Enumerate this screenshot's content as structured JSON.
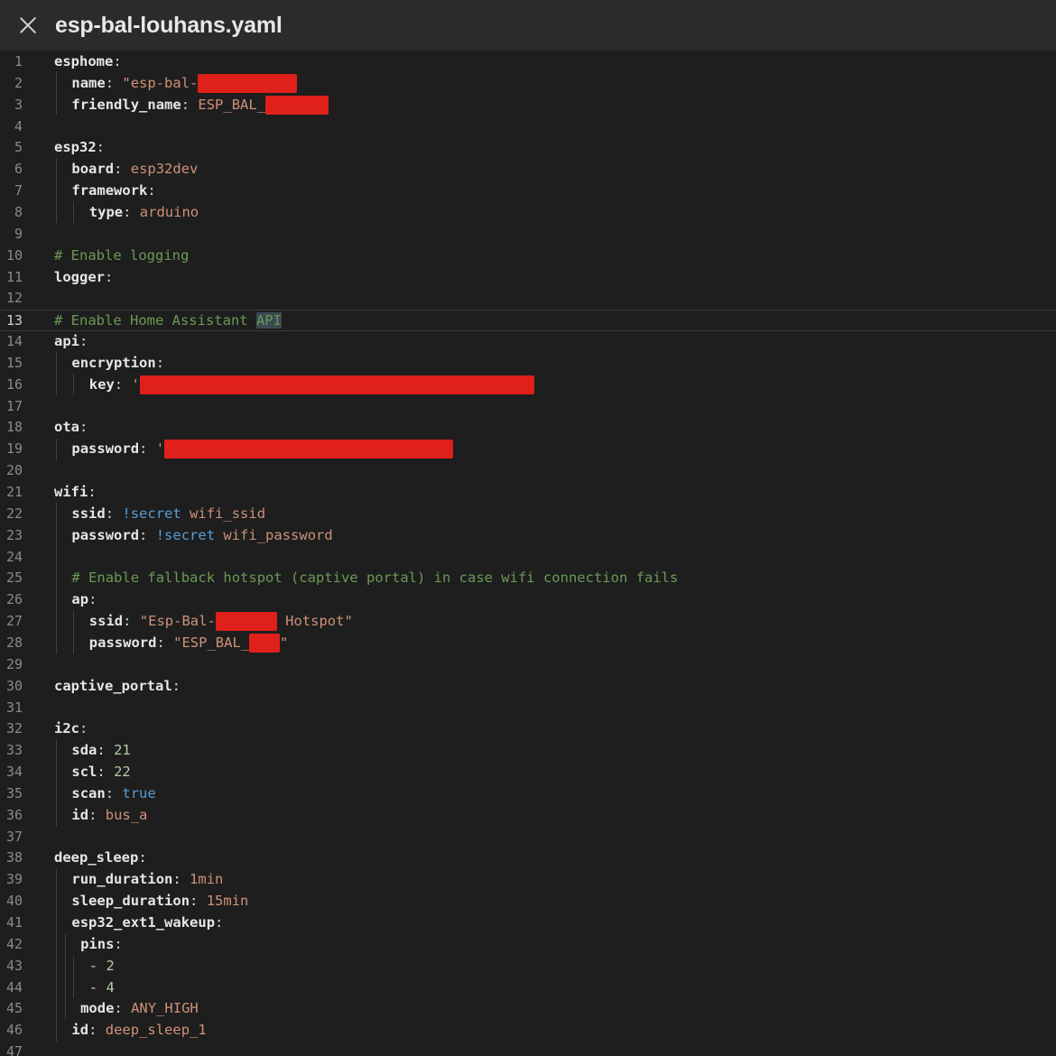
{
  "window": {
    "title": "esp-bal-louhans.yaml",
    "close_icon": "close-icon"
  },
  "colors": {
    "background": "#1e1e1e",
    "key": "#e6e6e6",
    "string": "#ce9178",
    "keyword": "#569cd6",
    "number": "#b5cea8",
    "comment": "#6a9955",
    "redaction": "#e0201a"
  },
  "editor": {
    "current_line": 13,
    "lines": [
      {
        "n": "1",
        "tokens": [
          [
            "k",
            "esphome"
          ],
          [
            "p",
            ":"
          ]
        ]
      },
      {
        "n": "2",
        "indent": 1,
        "tokens": [
          [
            "k",
            "name"
          ],
          [
            "p",
            ": "
          ],
          [
            "s",
            "\"esp-bal-"
          ],
          [
            "r",
            "110"
          ]
        ]
      },
      {
        "n": "3",
        "indent": 1,
        "tokens": [
          [
            "k",
            "friendly_name"
          ],
          [
            "p",
            ": "
          ],
          [
            "s",
            "ESP_BAL_"
          ],
          [
            "r",
            "70"
          ]
        ]
      },
      {
        "n": "4",
        "tokens": []
      },
      {
        "n": "5",
        "tokens": [
          [
            "k",
            "esp32"
          ],
          [
            "p",
            ":"
          ]
        ]
      },
      {
        "n": "6",
        "indent": 1,
        "tokens": [
          [
            "k",
            "board"
          ],
          [
            "p",
            ": "
          ],
          [
            "s",
            "esp32dev"
          ]
        ]
      },
      {
        "n": "7",
        "indent": 1,
        "tokens": [
          [
            "k",
            "framework"
          ],
          [
            "p",
            ":"
          ]
        ]
      },
      {
        "n": "8",
        "indent": 2,
        "tokens": [
          [
            "k",
            "type"
          ],
          [
            "p",
            ": "
          ],
          [
            "s",
            "arduino"
          ]
        ]
      },
      {
        "n": "9",
        "tokens": []
      },
      {
        "n": "10",
        "tokens": [
          [
            "c",
            "# Enable logging"
          ]
        ]
      },
      {
        "n": "11",
        "tokens": [
          [
            "k",
            "logger"
          ],
          [
            "p",
            ":"
          ]
        ]
      },
      {
        "n": "12",
        "tokens": []
      },
      {
        "n": "13",
        "tokens": [
          [
            "c",
            "# Enable Home Assistant "
          ],
          [
            "h",
            "API"
          ]
        ]
      },
      {
        "n": "14",
        "tokens": [
          [
            "k",
            "api"
          ],
          [
            "p",
            ":"
          ]
        ]
      },
      {
        "n": "15",
        "indent": 1,
        "tokens": [
          [
            "k",
            "encryption"
          ],
          [
            "p",
            ":"
          ]
        ]
      },
      {
        "n": "16",
        "indent": 2,
        "tokens": [
          [
            "k",
            "key"
          ],
          [
            "p",
            ": "
          ],
          [
            "s",
            "'"
          ],
          [
            "r",
            "437"
          ]
        ]
      },
      {
        "n": "17",
        "tokens": []
      },
      {
        "n": "18",
        "tokens": [
          [
            "k",
            "ota"
          ],
          [
            "p",
            ":"
          ]
        ]
      },
      {
        "n": "19",
        "indent": 1,
        "tokens": [
          [
            "k",
            "password"
          ],
          [
            "p",
            ": "
          ],
          [
            "s",
            "'"
          ],
          [
            "r",
            "320"
          ]
        ]
      },
      {
        "n": "20",
        "tokens": []
      },
      {
        "n": "21",
        "tokens": [
          [
            "k",
            "wifi"
          ],
          [
            "p",
            ":"
          ]
        ]
      },
      {
        "n": "22",
        "indent": 1,
        "tokens": [
          [
            "k",
            "ssid"
          ],
          [
            "p",
            ": "
          ],
          [
            "b",
            "!secret"
          ],
          [
            "s",
            " wifi_ssid"
          ]
        ]
      },
      {
        "n": "23",
        "indent": 1,
        "tokens": [
          [
            "k",
            "password"
          ],
          [
            "p",
            ": "
          ],
          [
            "b",
            "!secret"
          ],
          [
            "s",
            " wifi_password"
          ]
        ]
      },
      {
        "n": "24",
        "tokens": []
      },
      {
        "n": "25",
        "indent": 1,
        "tokens": [
          [
            "c",
            "# Enable fallback hotspot (captive portal) in case wifi connection fails"
          ]
        ]
      },
      {
        "n": "26",
        "indent": 1,
        "tokens": [
          [
            "k",
            "ap"
          ],
          [
            "p",
            ":"
          ]
        ]
      },
      {
        "n": "27",
        "indent": 2,
        "tokens": [
          [
            "k",
            "ssid"
          ],
          [
            "p",
            ": "
          ],
          [
            "s",
            "\"Esp-Bal-"
          ],
          [
            "r",
            "68"
          ],
          [
            "s",
            " Hotspot\""
          ]
        ]
      },
      {
        "n": "28",
        "indent": 2,
        "tokens": [
          [
            "k",
            "password"
          ],
          [
            "p",
            ": "
          ],
          [
            "s",
            "\"ESP_BAL_"
          ],
          [
            "r",
            "34"
          ],
          [
            "s",
            "\""
          ]
        ]
      },
      {
        "n": "29",
        "tokens": []
      },
      {
        "n": "30",
        "tokens": [
          [
            "k",
            "captive_portal"
          ],
          [
            "p",
            ":"
          ]
        ]
      },
      {
        "n": "31",
        "tokens": []
      },
      {
        "n": "32",
        "tokens": [
          [
            "k",
            "i2c"
          ],
          [
            "p",
            ":"
          ]
        ]
      },
      {
        "n": "33",
        "indent": 1,
        "tokens": [
          [
            "k",
            "sda"
          ],
          [
            "p",
            ": "
          ],
          [
            "n",
            "21"
          ]
        ]
      },
      {
        "n": "34",
        "indent": 1,
        "tokens": [
          [
            "k",
            "scl"
          ],
          [
            "p",
            ": "
          ],
          [
            "n",
            "22"
          ]
        ]
      },
      {
        "n": "35",
        "indent": 1,
        "tokens": [
          [
            "k",
            "scan"
          ],
          [
            "p",
            ": "
          ],
          [
            "b",
            "true"
          ]
        ]
      },
      {
        "n": "36",
        "indent": 1,
        "tokens": [
          [
            "k",
            "id"
          ],
          [
            "p",
            ": "
          ],
          [
            "s",
            "bus_a"
          ]
        ]
      },
      {
        "n": "37",
        "tokens": []
      },
      {
        "n": "38",
        "tokens": [
          [
            "k",
            "deep_sleep"
          ],
          [
            "p",
            ":"
          ]
        ]
      },
      {
        "n": "39",
        "indent": 1,
        "tokens": [
          [
            "k",
            "run_duration"
          ],
          [
            "p",
            ": "
          ],
          [
            "s",
            "1min"
          ]
        ]
      },
      {
        "n": "40",
        "indent": 1,
        "tokens": [
          [
            "k",
            "sleep_duration"
          ],
          [
            "p",
            ": "
          ],
          [
            "s",
            "15min"
          ]
        ]
      },
      {
        "n": "41",
        "indent": 1,
        "tokens": [
          [
            "k",
            "esp32_ext1_wakeup"
          ],
          [
            "p",
            ":"
          ]
        ]
      },
      {
        "n": "42",
        "indent": 1.5,
        "tokens": [
          [
            "k",
            "pins"
          ],
          [
            "p",
            ":"
          ]
        ]
      },
      {
        "n": "43",
        "indent": 2,
        "tokens": [
          [
            "p",
            "- "
          ],
          [
            "n",
            "2"
          ]
        ]
      },
      {
        "n": "44",
        "indent": 2,
        "tokens": [
          [
            "p",
            "- "
          ],
          [
            "n",
            "4"
          ]
        ]
      },
      {
        "n": "45",
        "indent": 1.5,
        "tokens": [
          [
            "k",
            "mode"
          ],
          [
            "p",
            ": "
          ],
          [
            "s",
            "ANY_HIGH"
          ]
        ]
      },
      {
        "n": "46",
        "indent": 1,
        "tokens": [
          [
            "k",
            "id"
          ],
          [
            "p",
            ": "
          ],
          [
            "s",
            "deep_sleep_1"
          ]
        ]
      },
      {
        "n": "47",
        "tokens": []
      }
    ]
  }
}
